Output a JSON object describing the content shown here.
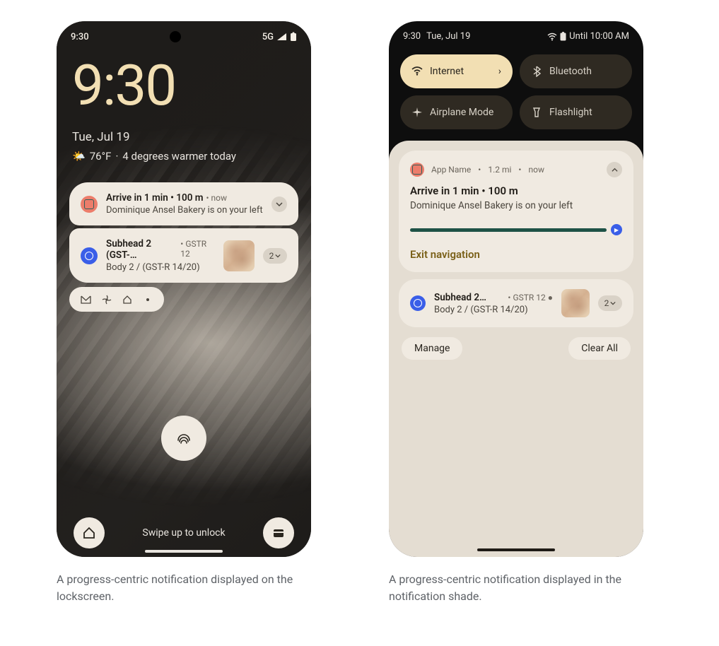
{
  "captions": {
    "left": "A progress-centric notification displayed on the lockscreen.",
    "right": "A progress-centric notification displayed in the notification shade."
  },
  "lockscreen": {
    "status": {
      "time": "9:30",
      "network": "5G"
    },
    "clock": "9:30",
    "date": "Tue, Jul 19",
    "weather": {
      "temp": "76°F",
      "detail": "4 degrees warmer today",
      "sep": "·"
    },
    "notifications": [
      {
        "icon": "coral",
        "title": "Arrive in 1 min • 100 m",
        "time": "now",
        "subtitle": "Dominique Ansel Bakery is on your left",
        "expandable": true
      },
      {
        "icon": "blue",
        "title": "Subhead 2 (GST-…",
        "meta": "GSTR 12",
        "subtitle": "Body 2 / (GST-R 14/20)",
        "thumb": true,
        "count": "2"
      }
    ],
    "unlock_hint": "Swipe up to unlock"
  },
  "shade": {
    "status": {
      "time": "9:30",
      "date": "Tue, Jul 19",
      "until": "Until 10:00 AM"
    },
    "qs": [
      {
        "label": "Internet",
        "icon": "wifi",
        "active": true,
        "arrow": true
      },
      {
        "label": "Bluetooth",
        "icon": "bluetooth"
      },
      {
        "label": "Airplane Mode",
        "icon": "airplane"
      },
      {
        "label": "Flashlight",
        "icon": "flashlight"
      }
    ],
    "main_notif": {
      "app": "App Name",
      "distance": "1.2 mi",
      "time": "now",
      "sep": "•",
      "title": "Arrive in 1 min • 100 m",
      "body": "Dominique Ansel Bakery is on your left",
      "exit_label": "Exit navigation"
    },
    "second_notif": {
      "title": "Subhead 2…",
      "meta": "GSTR 12",
      "body": "Body 2 / (GST-R 14/20)",
      "count": "2"
    },
    "actions": {
      "manage": "Manage",
      "clear": "Clear All"
    }
  }
}
